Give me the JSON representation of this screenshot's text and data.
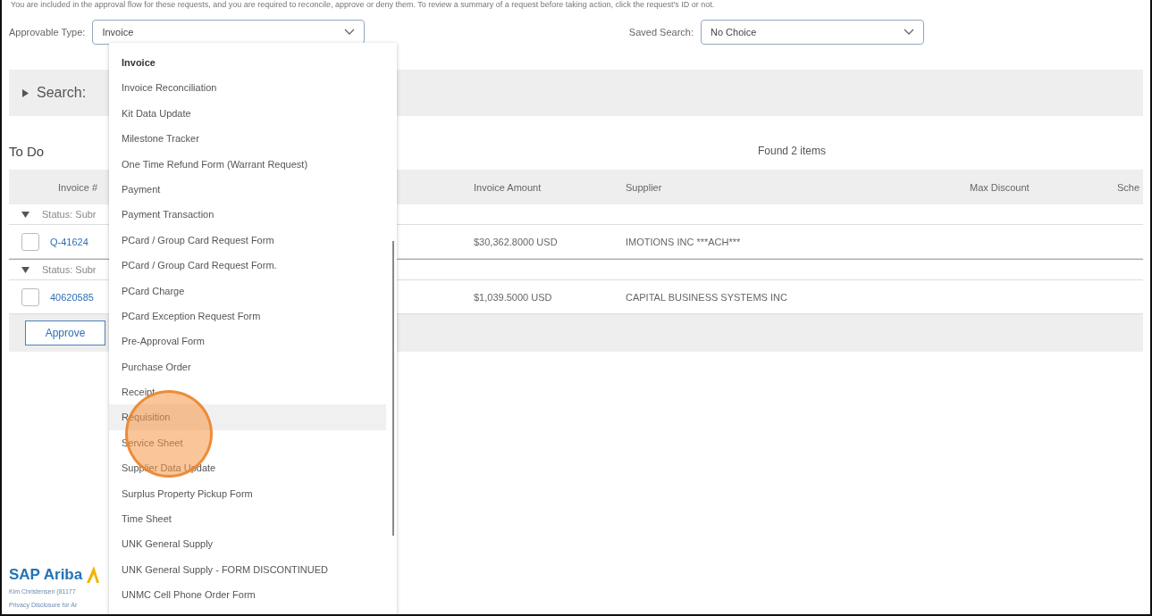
{
  "intro_text": "You are included in the approval flow for these requests, and you are required to reconcile, approve or deny them. To review a summary of a request before taking action, click the request's ID or not.",
  "filters": [
    {
      "label": "Approvable Type:",
      "value": "Invoice"
    },
    {
      "label": "Saved Search:",
      "value": "No Choice"
    }
  ],
  "search": {
    "label": "Search:",
    "expanded": false
  },
  "todo": {
    "title": "To Do",
    "count_text": "Found 2 items"
  },
  "table": {
    "columns": [
      "Invoice #",
      "Invoice Amount",
      "Supplier",
      "Max Discount",
      "Sche"
    ],
    "groups": [
      {
        "label": "Status: Subr",
        "expanded": true,
        "rows": [
          {
            "id": "Q-41624",
            "checked": false,
            "amount": "$30,362.8000 USD",
            "supplier": "IMOTIONS INC ***ACH***"
          }
        ]
      },
      {
        "label": "Status: Subr",
        "expanded": true,
        "rows": [
          {
            "id": "40620585",
            "checked": false,
            "amount": "$1,039.5000 USD",
            "supplier": "CAPITAL BUSINESS SYSTEMS INC"
          }
        ]
      }
    ]
  },
  "approve_button": "Approve",
  "dropdown": {
    "items": [
      {
        "label": "Invoice",
        "selected": true,
        "highlighted": false
      },
      {
        "label": "Invoice Reconciliation",
        "selected": false,
        "highlighted": false
      },
      {
        "label": "Kit Data Update",
        "selected": false,
        "highlighted": false
      },
      {
        "label": "Milestone Tracker",
        "selected": false,
        "highlighted": false
      },
      {
        "label": "One Time Refund Form (Warrant Request)",
        "selected": false,
        "highlighted": false
      },
      {
        "label": "Payment",
        "selected": false,
        "highlighted": false
      },
      {
        "label": "Payment Transaction",
        "selected": false,
        "highlighted": false
      },
      {
        "label": "PCard / Group Card Request Form",
        "selected": false,
        "highlighted": false
      },
      {
        "label": "PCard / Group Card Request Form.",
        "selected": false,
        "highlighted": false
      },
      {
        "label": "PCard Charge",
        "selected": false,
        "highlighted": false
      },
      {
        "label": "PCard Exception Request Form",
        "selected": false,
        "highlighted": false
      },
      {
        "label": "Pre-Approval Form",
        "selected": false,
        "highlighted": false
      },
      {
        "label": "Purchase Order",
        "selected": false,
        "highlighted": false
      },
      {
        "label": "Receipt",
        "selected": false,
        "highlighted": false
      },
      {
        "label": "Requisition",
        "selected": false,
        "highlighted": true
      },
      {
        "label": "Service Sheet",
        "selected": false,
        "highlighted": false
      },
      {
        "label": "Supplier Data Update",
        "selected": false,
        "highlighted": false
      },
      {
        "label": "Surplus Property Pickup Form",
        "selected": false,
        "highlighted": false
      },
      {
        "label": "Time Sheet",
        "selected": false,
        "highlighted": false
      },
      {
        "label": "UNK General Supply",
        "selected": false,
        "highlighted": false
      },
      {
        "label": "UNK General Supply - FORM DISCONTINUED",
        "selected": false,
        "highlighted": false
      },
      {
        "label": "UNMC Cell Phone Order Form",
        "selected": false,
        "highlighted": false
      }
    ]
  },
  "footer": {
    "logo": "SAP Ariba",
    "user_text": "Kim Christensen (81177",
    "privacy_text": "Privacy Disclosure for Ar"
  }
}
